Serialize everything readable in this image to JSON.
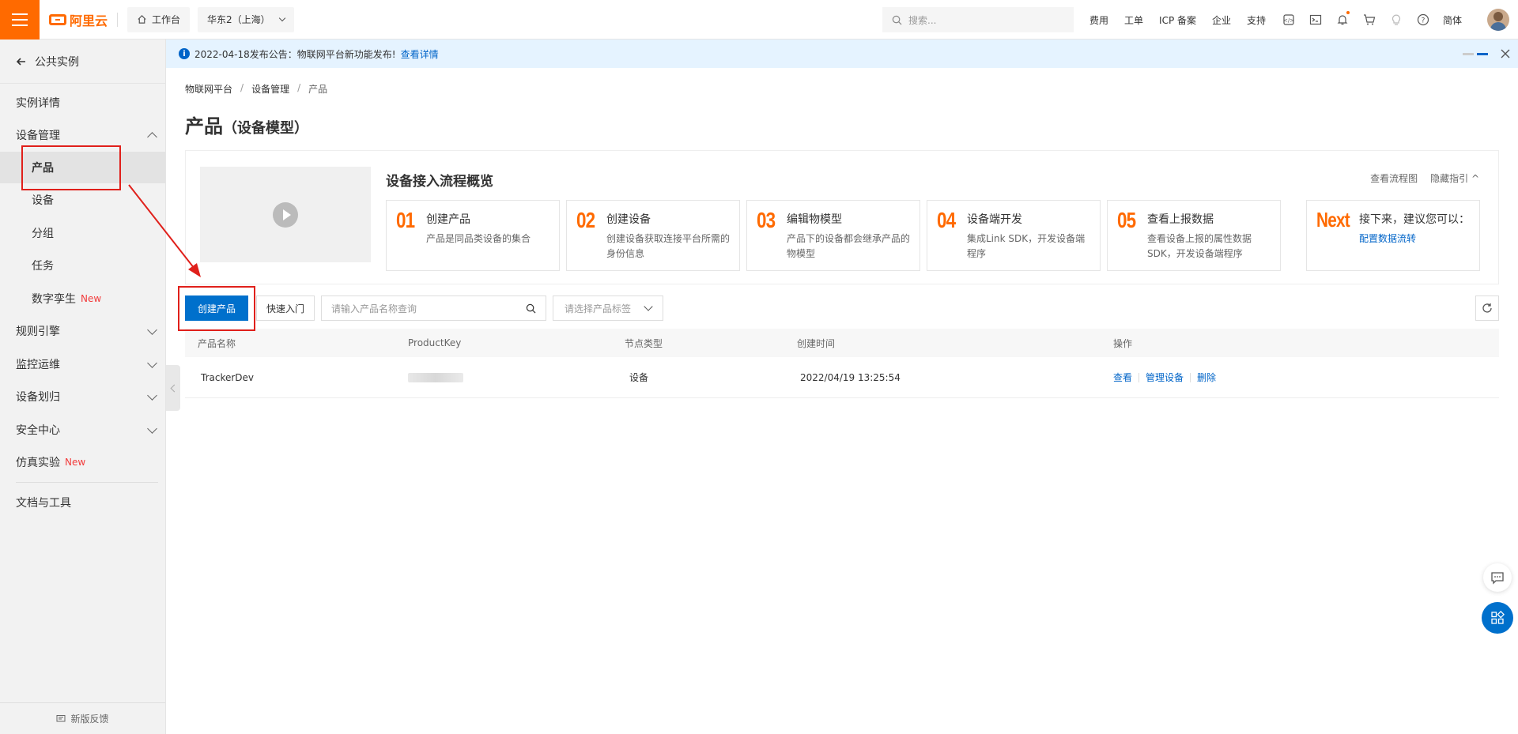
{
  "topbar": {
    "logo_text": "阿里云",
    "workbench": "工作台",
    "region": "华东2（上海）",
    "search_placeholder": "搜索...",
    "links": [
      "费用",
      "工单",
      "ICP 备案",
      "企业",
      "支持"
    ],
    "lang": "简体"
  },
  "sidebar": {
    "back_label": "公共实例",
    "items": {
      "instance_detail": "实例详情",
      "device_mgmt": "设备管理",
      "product": "产品",
      "device": "设备",
      "group": "分组",
      "task": "任务",
      "digital_twin": "数字孪生",
      "rule_engine": "规则引擎",
      "monitoring": "监控运维",
      "device_assign": "设备划归",
      "security": "安全中心",
      "simulation": "仿真实验",
      "docs": "文档与工具"
    },
    "new_tag": "New",
    "feedback": "新版反馈"
  },
  "notice": {
    "text": "2022-04-18发布公告：物联网平台新功能发布!",
    "link": "查看详情"
  },
  "breadcrumb": [
    "物联网平台",
    "设备管理",
    "产品"
  ],
  "page": {
    "title": "产品",
    "subtitle": "（设备模型）"
  },
  "guide": {
    "title": "设备接入流程概览",
    "view_flow": "查看流程图",
    "hide_guide": "隐藏指引",
    "steps": [
      {
        "num": "01",
        "title": "创建产品",
        "desc": "产品是同品类设备的集合"
      },
      {
        "num": "02",
        "title": "创建设备",
        "desc": "创建设备获取连接平台所需的身份信息"
      },
      {
        "num": "03",
        "title": "编辑物模型",
        "desc": "产品下的设备都会继承产品的物模型"
      },
      {
        "num": "04",
        "title": "设备端开发",
        "desc": "集成Link SDK，开发设备端程序"
      },
      {
        "num": "05",
        "title": "查看上报数据",
        "desc": "查看设备上报的属性数据 SDK，开发设备端程序"
      },
      {
        "num": "Next",
        "title": "接下来，建议您可以：",
        "desc": "配置数据流转"
      }
    ]
  },
  "toolbar": {
    "create_btn": "创建产品",
    "quick_start": "快速入门",
    "search_placeholder": "请输入产品名称查询",
    "tag_select": "请选择产品标签"
  },
  "table": {
    "headers": [
      "产品名称",
      "ProductKey",
      "节点类型",
      "创建时间",
      "操作"
    ],
    "rows": [
      {
        "name": "TrackerDev",
        "node_type": "设备",
        "created": "2022/04/19 13:25:54"
      }
    ],
    "ops": [
      "查看",
      "管理设备",
      "删除"
    ]
  },
  "colors": {
    "brand": "#ff6a00",
    "primary": "#0070cc",
    "link": "#0064c8",
    "highlight": "#e0201b"
  }
}
